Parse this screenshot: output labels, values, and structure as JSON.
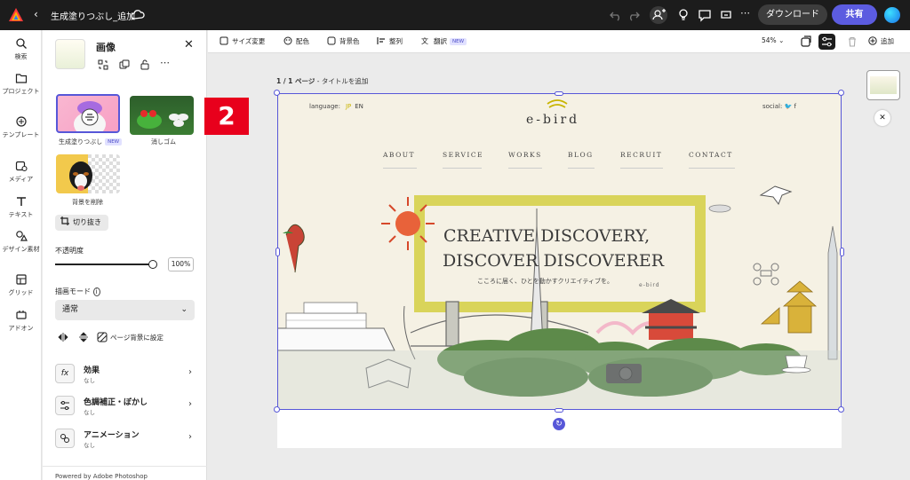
{
  "topbar": {
    "doc_title": "生成塗りつぶし_追加",
    "download_label": "ダウンロード",
    "share_label": "共有"
  },
  "rail": {
    "items": [
      {
        "label": "検索",
        "icon": "search-icon"
      },
      {
        "label": "プロジェクト",
        "icon": "folder-icon"
      },
      {
        "label": "テンプレート",
        "icon": "template-icon"
      },
      {
        "label": "メディア",
        "icon": "media-icon"
      },
      {
        "label": "テキスト",
        "icon": "text-icon"
      },
      {
        "label": "デザイン素材",
        "icon": "shapes-icon"
      },
      {
        "label": "グリッド",
        "icon": "grid-icon"
      },
      {
        "label": "アドオン",
        "icon": "addon-icon"
      }
    ]
  },
  "panel": {
    "title": "画像",
    "tiles": {
      "generative_fill": "生成塗りつぶし",
      "new_badge": "NEW",
      "eraser": "消しゴム",
      "remove_bg": "背景を削除"
    },
    "crop_label": "切り抜き",
    "opacity_label": "不透明度",
    "opacity_value": "100%",
    "opacity_level": 1.0,
    "blend_mode_label": "描画モード",
    "blend_mode_value": "通常",
    "set_page_bg_label": "ページ背景に設定",
    "effects": [
      {
        "title": "効果",
        "sub": "なし",
        "icon": "fx-icon"
      },
      {
        "title": "色調補正・ぼかし",
        "sub": "なし",
        "icon": "adjust-icon"
      },
      {
        "title": "アニメーション",
        "sub": "なし",
        "icon": "animation-icon"
      }
    ],
    "powered_by": "Powered by Adobe Photoshop"
  },
  "annotation_badge": "2",
  "toolbar": {
    "resize": "サイズ変更",
    "color": "配色",
    "background": "背景色",
    "arrange": "整列",
    "translate": "翻訳",
    "new_badge": "NEW",
    "zoom": "54%",
    "add": "追加"
  },
  "page_label_strong": "1 / 1 ページ",
  "page_label_rest": " - タイトルを追加",
  "website": {
    "language_label": "language:",
    "lang_jp": "JP",
    "lang_en": "EN",
    "social_label": "social:",
    "logo": "e-bird",
    "nav": [
      "ABOUT",
      "SERVICE",
      "WORKS",
      "BLOG",
      "RECRUIT",
      "CONTACT"
    ],
    "hero_line1": "CREATIVE DISCOVERY,",
    "hero_line2": "DISCOVER DISCOVERER",
    "hero_sub": "こころに届く、ひとを動かすクリエイティブを。",
    "mini_logo": "e-bird"
  },
  "colors": {
    "accent": "#5c5ce0",
    "topbar": "#1c1c1c",
    "badge_red": "#e8001c",
    "hero_frame": "#d6d04a"
  }
}
